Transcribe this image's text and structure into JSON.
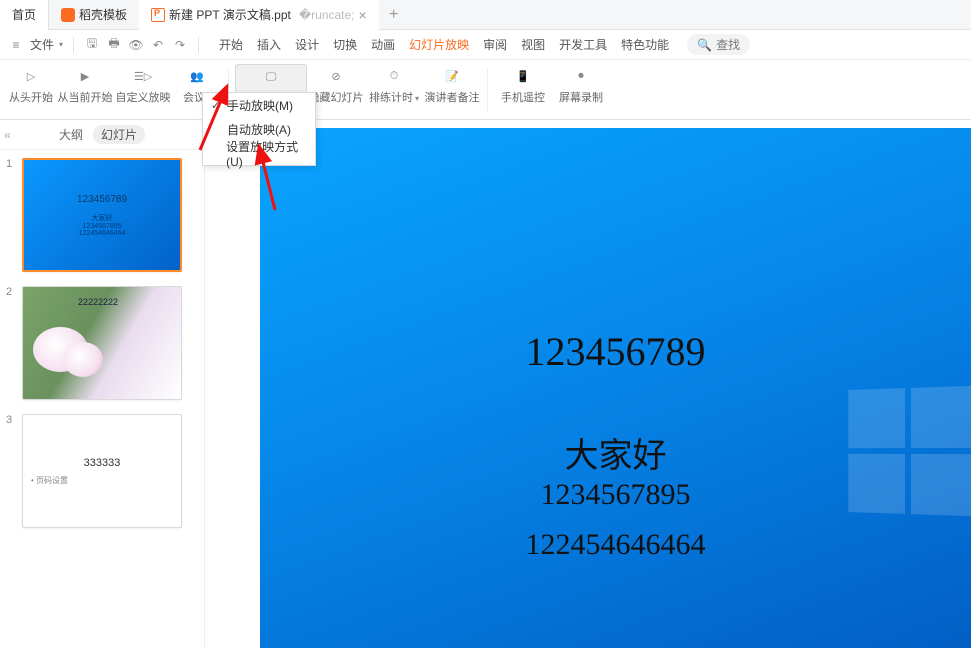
{
  "tabs": {
    "home": "首页",
    "template": "稻壳模板",
    "doc": "新建 PPT 演示文稿.ppt",
    "add": "+"
  },
  "quickbar": {
    "file": "文件",
    "undo": "↶",
    "redo": "↷"
  },
  "menu": {
    "start": "开始",
    "insert": "插入",
    "design": "设计",
    "transition": "切换",
    "animation": "动画",
    "slideshow": "幻灯片放映",
    "review": "审阅",
    "view": "视图",
    "devtools": "开发工具",
    "special": "特色功能",
    "search": "查找"
  },
  "ribbon": {
    "from_start": "从头开始",
    "from_current": "从当前开始",
    "custom_show": "自定义放映",
    "meeting": "会议",
    "setup_show": "设置放映方式",
    "hide_slide": "隐藏幻灯片",
    "rehearse": "排练计时",
    "speaker_notes": "演讲者备注",
    "mobile_remote": "手机遥控",
    "screen_record": "屏幕录制"
  },
  "dropdown": {
    "manual": "手动放映(M)",
    "auto": "自动放映(A)",
    "setup": "设置放映方式(U)"
  },
  "side": {
    "outline": "大纲",
    "slides": "幻灯片"
  },
  "thumbs": {
    "t1_a": "123456789",
    "t1_b": "大家好",
    "t1_c": "1234567895",
    "t1_d": "122454646464",
    "t2_a": "22222222",
    "t3_a": "333333",
    "t3_b": "页码设置"
  },
  "slide": {
    "line1": "123456789",
    "line2": "大家好",
    "line3": "1234567895",
    "line4": "122454646464"
  }
}
